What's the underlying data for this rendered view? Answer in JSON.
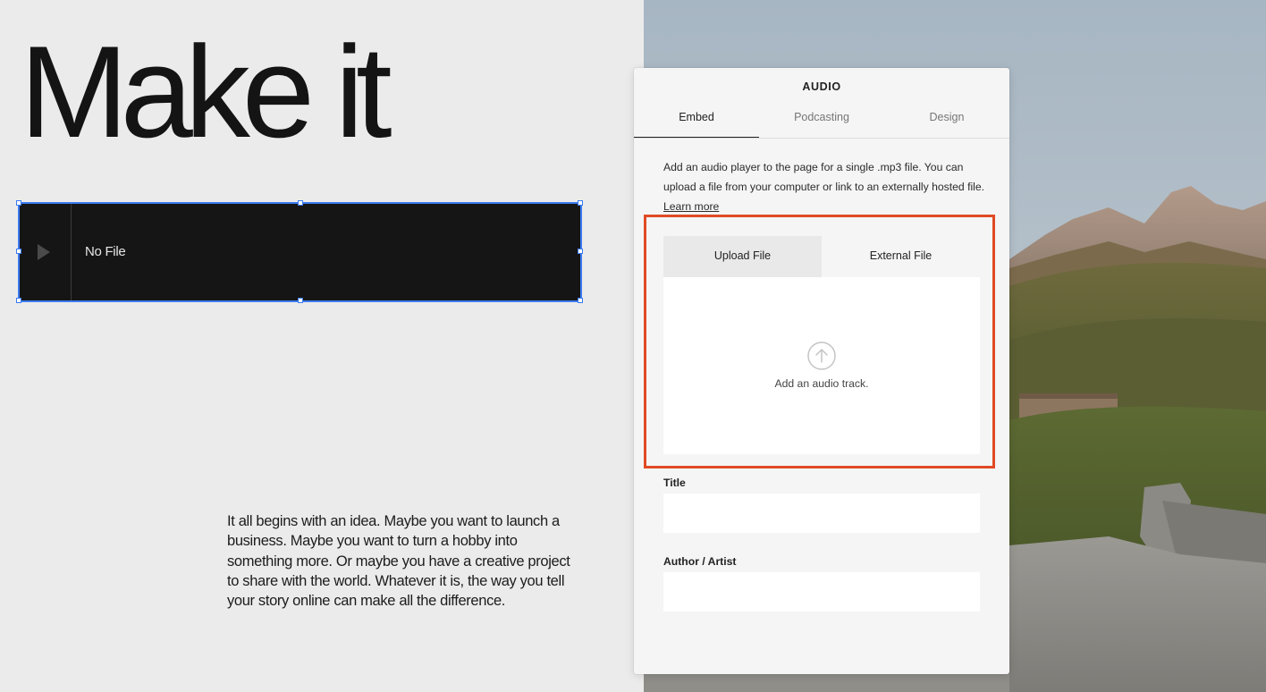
{
  "page": {
    "headline": "Make it",
    "body_text": "It all begins with an idea. Maybe you want to launch a business. Maybe you want to turn a hobby into something more. Or maybe you have a creative project to share with the world. Whatever it is, the way you tell your story online can make all the difference."
  },
  "audio_block": {
    "status_text": "No File",
    "play_icon": "play-icon"
  },
  "panel": {
    "title": "AUDIO",
    "tabs": [
      {
        "label": "Embed",
        "active": true
      },
      {
        "label": "Podcasting",
        "active": false
      },
      {
        "label": "Design",
        "active": false
      }
    ],
    "description": "Add an audio player to the page for a single .mp3 file. You can upload a file from your computer or link to an externally hosted file.",
    "learn_more": "Learn more",
    "source_tabs": [
      {
        "label": "Upload File",
        "active": true
      },
      {
        "label": "External File",
        "active": false
      }
    ],
    "dropzone_text": "Add an audio track.",
    "dropzone_icon": "upload-arrow-icon",
    "fields": {
      "title_label": "Title",
      "title_value": "",
      "author_label": "Author / Artist",
      "author_value": ""
    }
  },
  "colors": {
    "highlight": "#e04b25",
    "selection": "#3b7bf2",
    "audio_bg": "#151515"
  }
}
